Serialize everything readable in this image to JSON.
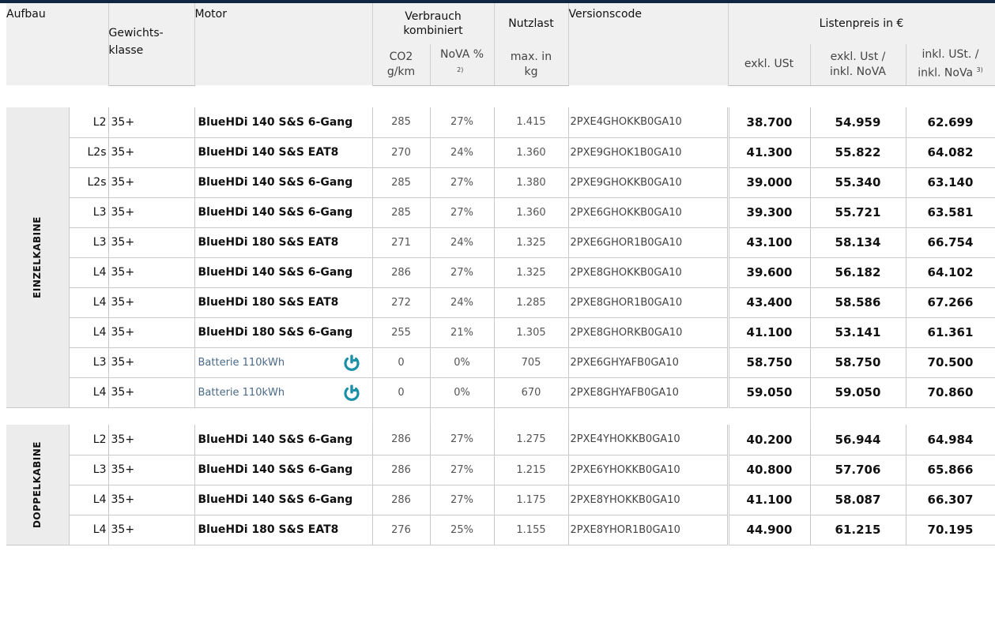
{
  "header": {
    "aufbau": "Aufbau",
    "gewicht1": "Gewichts-",
    "gewicht2": "klasse",
    "motor": "Motor",
    "verbrauch1": "Verbrauch",
    "verbrauch2": "kombiniert",
    "co2a": "CO2",
    "co2b": "g/km",
    "nova": "NoVA %",
    "nova_sup": "2)",
    "nutzlast": "Nutzlast",
    "maxa": "max. in",
    "maxb": "kg",
    "version": "Versionscode",
    "listenpreis": "Listenpreis in €",
    "p1": "exkl. USt",
    "p2a": "exkl. Ust /",
    "p2b": "inkl. NoVA",
    "p3a": "inkl. USt. /",
    "p3b": "inkl. NoVa",
    "p3_sup": "3)"
  },
  "groups": [
    {
      "label": "EINZELKABINE"
    },
    {
      "label": "DOPPELKABINE"
    }
  ],
  "rows": [
    {
      "len": "L2",
      "klasse": "35+",
      "motor": "BlueHDi 140 S&S 6-Gang",
      "co2": "285",
      "nova": "27%",
      "nutz": "1.415",
      "code": "2PXE4GHOKKB0GA10",
      "p1": "38.700",
      "p2": "54.959",
      "p3": "62.699"
    },
    {
      "len": "L2s",
      "klasse": "35+",
      "motor": "BlueHDi 140 S&S EAT8",
      "co2": "270",
      "nova": "24%",
      "nutz": "1.360",
      "code": "2PXE9GHOK1B0GA10",
      "p1": "41.300",
      "p2": "55.822",
      "p3": "64.082"
    },
    {
      "len": "L2s",
      "klasse": "35+",
      "motor": "BlueHDi 140 S&S 6-Gang",
      "co2": "285",
      "nova": "27%",
      "nutz": "1.380",
      "code": "2PXE9GHOKKB0GA10",
      "p1": "39.000",
      "p2": "55.340",
      "p3": "63.140"
    },
    {
      "len": "L3",
      "klasse": "35+",
      "motor": "BlueHDi 140 S&S 6-Gang",
      "co2": "285",
      "nova": "27%",
      "nutz": "1.360",
      "code": "2PXE6GHOKKB0GA10",
      "p1": "39.300",
      "p2": "55.721",
      "p3": "63.581"
    },
    {
      "len": "L3",
      "klasse": "35+",
      "motor": "BlueHDi 180 S&S EAT8",
      "co2": "271",
      "nova": "24%",
      "nutz": "1.325",
      "code": "2PXE6GHOR1B0GA10",
      "p1": "43.100",
      "p2": "58.134",
      "p3": "66.754"
    },
    {
      "len": "L4",
      "klasse": "35+",
      "motor": "BlueHDi 140 S&S 6-Gang",
      "co2": "286",
      "nova": "27%",
      "nutz": "1.325",
      "code": "2PXE8GHOKKB0GA10",
      "p1": "39.600",
      "p2": "56.182",
      "p3": "64.102"
    },
    {
      "len": "L4",
      "klasse": "35+",
      "motor": "BlueHDi 180 S&S EAT8",
      "co2": "272",
      "nova": "24%",
      "nutz": "1.285",
      "code": "2PXE8GHOR1B0GA10",
      "p1": "43.400",
      "p2": "58.586",
      "p3": "67.266"
    },
    {
      "len": "L4",
      "klasse": "35+",
      "motor": "BlueHDi 180 S&S 6-Gang",
      "co2": "255",
      "nova": "21%",
      "nutz": "1.305",
      "code": "2PXE8GHORKB0GA10",
      "p1": "41.100",
      "p2": "53.141",
      "p3": "61.361"
    },
    {
      "len": "L3",
      "klasse": "35+",
      "motor": "Batterie 110kWh",
      "co2": "0",
      "nova": "0%",
      "nutz": "705",
      "code": "2PXE6GHYAFB0GA10",
      "p1": "58.750",
      "p2": "58.750",
      "p3": "70.500"
    },
    {
      "len": "L4",
      "klasse": "35+",
      "motor": "Batterie 110kWh",
      "co2": "0",
      "nova": "0%",
      "nutz": "670",
      "code": "2PXE8GHYAFB0GA10",
      "p1": "59.050",
      "p2": "59.050",
      "p3": "70.860"
    },
    {
      "len": "L2",
      "klasse": "35+",
      "motor": "BlueHDi 140 S&S 6-Gang",
      "co2": "286",
      "nova": "27%",
      "nutz": "1.275",
      "code": "2PXE4YHOKKB0GA10",
      "p1": "40.200",
      "p2": "56.944",
      "p3": "64.984"
    },
    {
      "len": "L3",
      "klasse": "35+",
      "motor": "BlueHDi 140 S&S 6-Gang",
      "co2": "286",
      "nova": "27%",
      "nutz": "1.215",
      "code": "2PXE6YHOKKB0GA10",
      "p1": "40.800",
      "p2": "57.706",
      "p3": "65.866"
    },
    {
      "len": "L4",
      "klasse": "35+",
      "motor": "BlueHDi 140 S&S 6-Gang",
      "co2": "286",
      "nova": "27%",
      "nutz": "1.175",
      "code": "2PXE8YHOKKB0GA10",
      "p1": "41.100",
      "p2": "58.087",
      "p3": "66.307"
    },
    {
      "len": "L4",
      "klasse": "35+",
      "motor": "BlueHDi 180 S&S EAT8",
      "co2": "276",
      "nova": "25%",
      "nutz": "1.155",
      "code": "2PXE8YHOR1B0GA10",
      "p1": "44.900",
      "p2": "61.215",
      "p3": "70.195"
    }
  ],
  "colors": {
    "topbar": "#0f2740",
    "header_bg": "#f0f0f0",
    "ev_icon": "#1a8fa8",
    "ev_text": "#4a6a8a"
  },
  "icons": {
    "ev": "power-plug-icon"
  }
}
